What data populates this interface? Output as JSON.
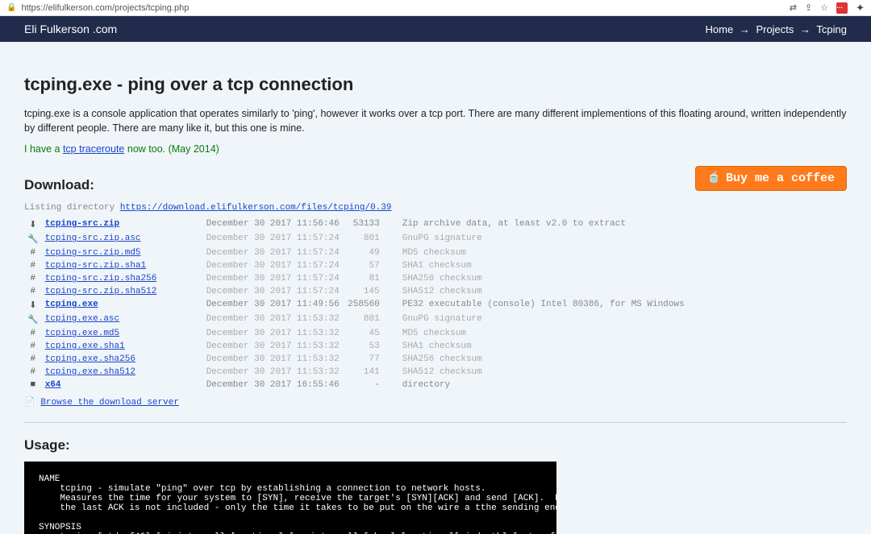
{
  "browser": {
    "url": "https://elifulkerson.com/projects/tcping.php",
    "ext_red": "…"
  },
  "nav": {
    "brand": "Eli Fulkerson .com",
    "crumb1": "Home",
    "crumb2": "Projects",
    "crumb3": "Tcping",
    "arrow": "→"
  },
  "page": {
    "title": "tcping.exe - ping over a tcp connection",
    "intro": "tcping.exe is a console application that operates similarly to 'ping', however it works over a tcp port. There are many different implementions of this floating around, written independently by different people. There are many like it, but this one is mine.",
    "note_prefix": "I have a ",
    "note_link": "tcp traceroute",
    "note_suffix": " now too. (May 2014)",
    "download_heading": "Download:",
    "usage_heading": "Usage:",
    "coffee_label": "Buy me a coffee",
    "listing_prefix": "Listing directory ",
    "listing_url": "https://download.elifulkerson.com/files/tcping/0.39",
    "browse_icon": "📄",
    "browse_label": "Browse the download server"
  },
  "files": [
    {
      "icon": "download",
      "name": "tcping-src.zip",
      "bold": true,
      "date": "December 30 2017 11:56:46",
      "size": "53133",
      "desc": "Zip archive data, at least v2.0 to extract",
      "dim": false
    },
    {
      "icon": "key",
      "name": "tcping-src.zip.asc",
      "bold": false,
      "date": "December 30 2017 11:57:24",
      "size": "801",
      "desc": "GnuPG signature",
      "dim": true
    },
    {
      "icon": "hash",
      "name": "tcping-src.zip.md5",
      "bold": false,
      "date": "December 30 2017 11:57:24",
      "size": "49",
      "desc": "MD5 checksum",
      "dim": true
    },
    {
      "icon": "hash",
      "name": "tcping-src.zip.sha1",
      "bold": false,
      "date": "December 30 2017 11:57:24",
      "size": "57",
      "desc": "SHA1 checksum",
      "dim": true
    },
    {
      "icon": "hash",
      "name": "tcping-src.zip.sha256",
      "bold": false,
      "date": "December 30 2017 11:57:24",
      "size": "81",
      "desc": "SHA256 checksum",
      "dim": true
    },
    {
      "icon": "hash",
      "name": "tcping-src.zip.sha512",
      "bold": false,
      "date": "December 30 2017 11:57:24",
      "size": "145",
      "desc": "SHA512 checksum",
      "dim": true
    },
    {
      "icon": "download",
      "name": "tcping.exe",
      "bold": true,
      "date": "December 30 2017 11:49:56",
      "size": "258560",
      "desc": "PE32 executable (console) Intel 80386, for MS Windows",
      "dim": false
    },
    {
      "icon": "key",
      "name": "tcping.exe.asc",
      "bold": false,
      "date": "December 30 2017 11:53:32",
      "size": "801",
      "desc": "GnuPG signature",
      "dim": true
    },
    {
      "icon": "hash",
      "name": "tcping.exe.md5",
      "bold": false,
      "date": "December 30 2017 11:53:32",
      "size": "45",
      "desc": "MD5 checksum",
      "dim": true
    },
    {
      "icon": "hash",
      "name": "tcping.exe.sha1",
      "bold": false,
      "date": "December 30 2017 11:53:32",
      "size": "53",
      "desc": "SHA1 checksum",
      "dim": true
    },
    {
      "icon": "hash",
      "name": "tcping.exe.sha256",
      "bold": false,
      "date": "December 30 2017 11:53:32",
      "size": "77",
      "desc": "SHA256 checksum",
      "dim": true
    },
    {
      "icon": "hash",
      "name": "tcping.exe.sha512",
      "bold": false,
      "date": "December 30 2017 11:53:32",
      "size": "141",
      "desc": "SHA512 checksum",
      "dim": true
    },
    {
      "icon": "folder",
      "name": "x64",
      "bold": true,
      "date": "December 30 2017 16:55:46",
      "size": "-",
      "desc": "directory",
      "dim": false
    }
  ],
  "icons": {
    "download": "⬇",
    "key": "🔧",
    "hash": "#",
    "folder": "■"
  },
  "terminal": "NAME\n    tcping - simulate \"ping\" over tcp by establishing a connection to network hosts.\n    Measures the time for your system to [SYN], receive the target's [SYN][ACK] and send [ACK].  Note that the travel time for\n    the last ACK is not included - only the time it takes to be put on the wire a tthe sending end.\n\nSYNOPSIS\n    tcping [-tdsvf46] [-i interval] [-n times] [-w interval] [-b n] [-r times][-j depth] [--tee filename] [-f] destination [port]"
}
